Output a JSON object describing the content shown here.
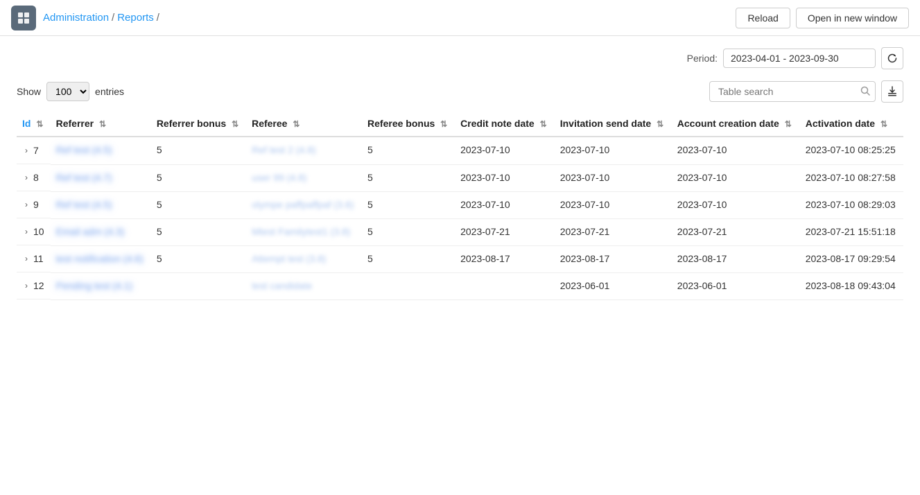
{
  "header": {
    "app_icon": "📊",
    "breadcrumb": [
      {
        "label": "Administration",
        "link": true
      },
      {
        "label": "Reports",
        "link": true
      },
      {
        "label": "",
        "link": false
      }
    ],
    "reload_label": "Reload",
    "open_new_window_label": "Open in new window"
  },
  "period": {
    "label": "Period:",
    "value": "2023-04-01 - 2023-09-30"
  },
  "toolbar": {
    "show_label": "Show",
    "entries_label": "entries",
    "entries_value": "100",
    "search_placeholder": "Table search",
    "export_icon": "export-icon"
  },
  "table": {
    "columns": [
      {
        "key": "id",
        "label": "Id",
        "sortable": true
      },
      {
        "key": "referrer",
        "label": "Referrer",
        "sortable": true
      },
      {
        "key": "referrer_bonus",
        "label": "Referrer bonus",
        "sortable": true
      },
      {
        "key": "referee",
        "label": "Referee",
        "sortable": true
      },
      {
        "key": "referee_bonus",
        "label": "Referee bonus",
        "sortable": true
      },
      {
        "key": "credit_note_date",
        "label": "Credit note date",
        "sortable": true
      },
      {
        "key": "invitation_send_date",
        "label": "Invitation send date",
        "sortable": true
      },
      {
        "key": "account_creation_date",
        "label": "Account creation date",
        "sortable": true
      },
      {
        "key": "activation_date",
        "label": "Activation date",
        "sortable": true
      }
    ],
    "rows": [
      {
        "id": "7",
        "referrer": "Ref test (4.5)",
        "referrer_bonus": "5",
        "referee": "Ref test 2 (4.8)",
        "referee_bonus": "5",
        "credit_note_date": "2023-07-10",
        "invitation_send_date": "2023-07-10",
        "account_creation_date": "2023-07-10",
        "activation_date": "2023-07-10 08:25:25"
      },
      {
        "id": "8",
        "referrer": "Ref test (4.7)",
        "referrer_bonus": "5",
        "referee": "user 99 (4.8)",
        "referee_bonus": "5",
        "credit_note_date": "2023-07-10",
        "invitation_send_date": "2023-07-10",
        "account_creation_date": "2023-07-10",
        "activation_date": "2023-07-10 08:27:58"
      },
      {
        "id": "9",
        "referrer": "Ref test (4.5)",
        "referrer_bonus": "5",
        "referee": "olympe paffpaffpaf (3.6)",
        "referee_bonus": "5",
        "credit_note_date": "2023-07-10",
        "invitation_send_date": "2023-07-10",
        "account_creation_date": "2023-07-10",
        "activation_date": "2023-07-10 08:29:03"
      },
      {
        "id": "10",
        "referrer": "Email adm (4.3)",
        "referrer_bonus": "5",
        "referee": "Mtest Familytest1 (3.8)",
        "referee_bonus": "5",
        "credit_note_date": "2023-07-21",
        "invitation_send_date": "2023-07-21",
        "account_creation_date": "2023-07-21",
        "activation_date": "2023-07-21 15:51:18"
      },
      {
        "id": "11",
        "referrer": "test notification (4.6)",
        "referrer_bonus": "5",
        "referee": "Attempt test (3.8)",
        "referee_bonus": "5",
        "credit_note_date": "2023-08-17",
        "invitation_send_date": "2023-08-17",
        "account_creation_date": "2023-08-17",
        "activation_date": "2023-08-17 09:29:54"
      },
      {
        "id": "12",
        "referrer": "Pending test (4.1)",
        "referrer_bonus": "",
        "referee": "test candidate",
        "referee_bonus": "",
        "credit_note_date": "",
        "invitation_send_date": "2023-06-01",
        "account_creation_date": "2023-06-01",
        "activation_date": "2023-08-18 09:43:04"
      }
    ]
  }
}
